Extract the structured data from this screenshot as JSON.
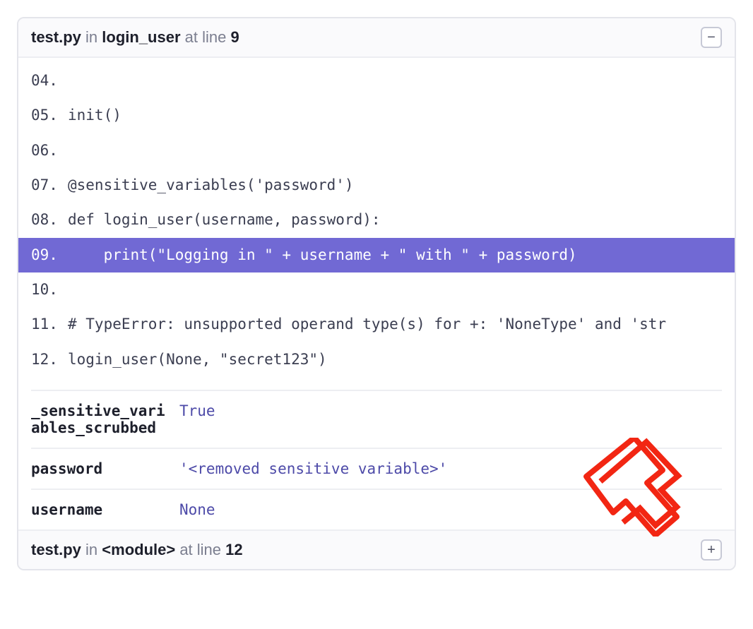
{
  "frame1": {
    "file": "test.py",
    "in_word": " in ",
    "func": "login_user",
    "at_line": " at line ",
    "line": "9",
    "collapse_glyph": "−"
  },
  "frame2": {
    "file": "test.py",
    "in_word": " in ",
    "func": "<module>",
    "at_line": " at line ",
    "line": "12",
    "expand_glyph": "+"
  },
  "code": [
    {
      "n": "04.",
      "t": ""
    },
    {
      "n": "05.",
      "t": "init()"
    },
    {
      "n": "06.",
      "t": ""
    },
    {
      "n": "07.",
      "t": "@sensitive_variables('password')"
    },
    {
      "n": "08.",
      "t": "def login_user(username, password):"
    },
    {
      "n": "09.",
      "t": "    print(\"Logging in \" + username + \" with \" + password)"
    },
    {
      "n": "10.",
      "t": ""
    },
    {
      "n": "11.",
      "t": "# TypeError: unsupported operand type(s) for +: 'NoneType' and 'str"
    },
    {
      "n": "12.",
      "t": "login_user(None, \"secret123\")"
    }
  ],
  "highlighted_index": 5,
  "vars": [
    {
      "name": "_sensitive_variables_scrubbed",
      "value": "True"
    },
    {
      "name": "password",
      "value": "'<removed sensitive variable>'"
    },
    {
      "name": "username",
      "value": "None"
    }
  ]
}
